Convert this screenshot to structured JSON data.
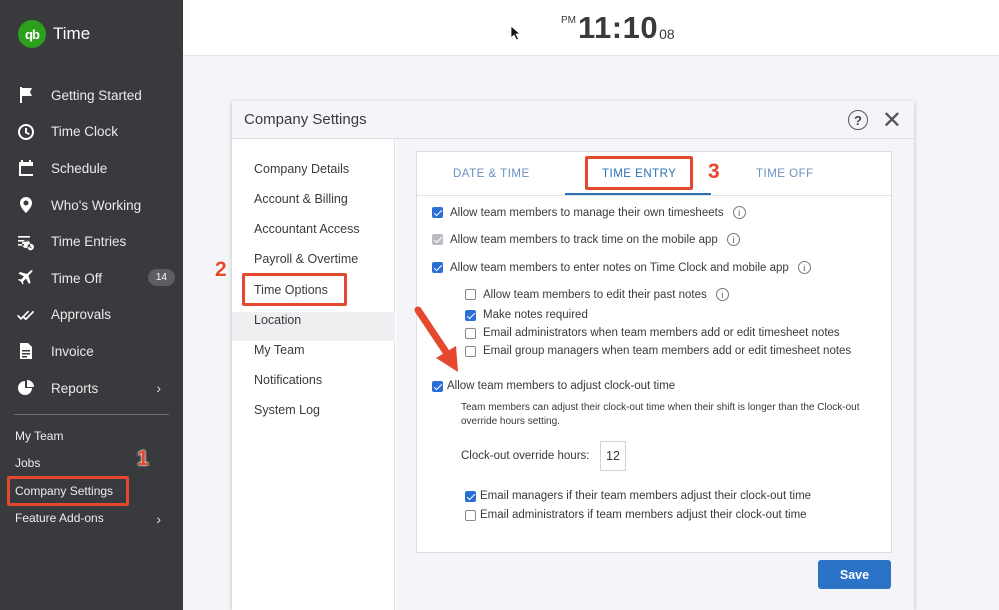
{
  "app": {
    "name": "Time",
    "logo_text": "qb"
  },
  "sidebar": {
    "items": [
      {
        "label": "Getting Started",
        "icon": "flag-icon"
      },
      {
        "label": "Time Clock",
        "icon": "clock-icon"
      },
      {
        "label": "Schedule",
        "icon": "calendar-icon"
      },
      {
        "label": "Who's Working",
        "icon": "location-pin-icon"
      },
      {
        "label": "Time Entries",
        "icon": "list-clock-icon"
      },
      {
        "label": "Time Off",
        "icon": "airplane-icon",
        "badge": "14"
      },
      {
        "label": "Approvals",
        "icon": "double-check-icon"
      },
      {
        "label": "Invoice",
        "icon": "document-icon"
      },
      {
        "label": "Reports",
        "icon": "pie-chart-icon",
        "chevron": "›"
      }
    ],
    "secondary": [
      {
        "label": "My Team"
      },
      {
        "label": "Jobs"
      },
      {
        "label": "Company Settings"
      },
      {
        "label": "Feature Add-ons",
        "chevron": "›"
      }
    ]
  },
  "header": {
    "ampm": "PM",
    "time": "11:10",
    "seconds": "08"
  },
  "modal": {
    "title": "Company Settings",
    "help_glyph": "?",
    "close_glyph": "✕",
    "menu": [
      "Company Details",
      "Account & Billing",
      "Accountant Access",
      "Payroll & Overtime",
      "Time Options",
      "Location",
      "My Team",
      "Notifications",
      "System Log"
    ],
    "tabs": [
      "DATE & TIME",
      "TIME ENTRY",
      "TIME OFF"
    ],
    "options": {
      "manage_timesheets": "Allow team members to manage their own timesheets",
      "track_mobile": "Allow team members to track time on the mobile app",
      "enter_notes": "Allow team members to enter notes on Time Clock and mobile app",
      "edit_past_notes": "Allow team members to edit their past notes",
      "notes_required": "Make notes required",
      "email_admins_notes": "Email administrators when team members add or edit timesheet notes",
      "email_group_managers": "Email group managers when team members add or edit timesheet notes",
      "adjust_clockout": "Allow team members to adjust clock-out time",
      "adjust_desc": "Team members can adjust their clock-out time when their shift is longer than the Clock-out override hours setting.",
      "override_label": "Clock-out override hours:",
      "override_value": "12",
      "email_managers_adjust": "Email managers if their team members adjust their clock-out time",
      "email_admins_adjust": "Email administrators if team members adjust their clock-out time"
    },
    "info_glyph": "i",
    "save_label": "Save"
  },
  "annotations": {
    "step1": "1",
    "step2": "2",
    "step3": "3"
  },
  "colors": {
    "sidebar": "#393a3d",
    "brand_green": "#2ca01c",
    "accent_blue": "#2a73c7",
    "annotation_red": "#e4492f"
  }
}
